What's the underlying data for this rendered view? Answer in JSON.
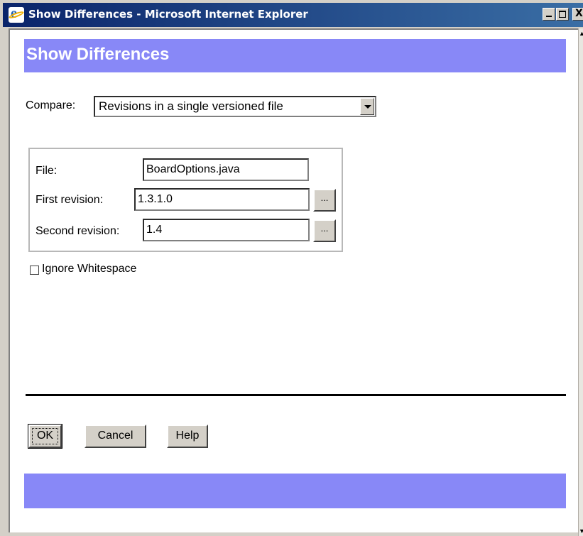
{
  "window": {
    "title": "Show Differences - Microsoft Internet Explorer",
    "minimize_glyph": "_",
    "close_glyph": "X"
  },
  "page": {
    "heading": "Show Differences"
  },
  "compare": {
    "label": "Compare:",
    "selected": "Revisions in a single versioned file"
  },
  "fields": {
    "file_label": "File:",
    "file_value": "BoardOptions.java",
    "first_label": "First revision:",
    "first_value": "1.3.1.0",
    "second_label": "Second revision:",
    "second_value": "1.4",
    "browse_label": "..."
  },
  "options": {
    "ignore_whitespace_label": "Ignore Whitespace",
    "ignore_whitespace_checked": false
  },
  "buttons": {
    "ok": "OK",
    "cancel": "Cancel",
    "help": "Help"
  },
  "colors": {
    "banner": "#8888f7",
    "titlebar_start": "#0a246a",
    "titlebar_end": "#3a6ea5"
  },
  "icons": [
    "ie-icon",
    "minimize-icon",
    "maximize-icon",
    "close-icon",
    "dropdown-arrow-icon",
    "scroll-up-icon",
    "scroll-down-icon"
  ]
}
